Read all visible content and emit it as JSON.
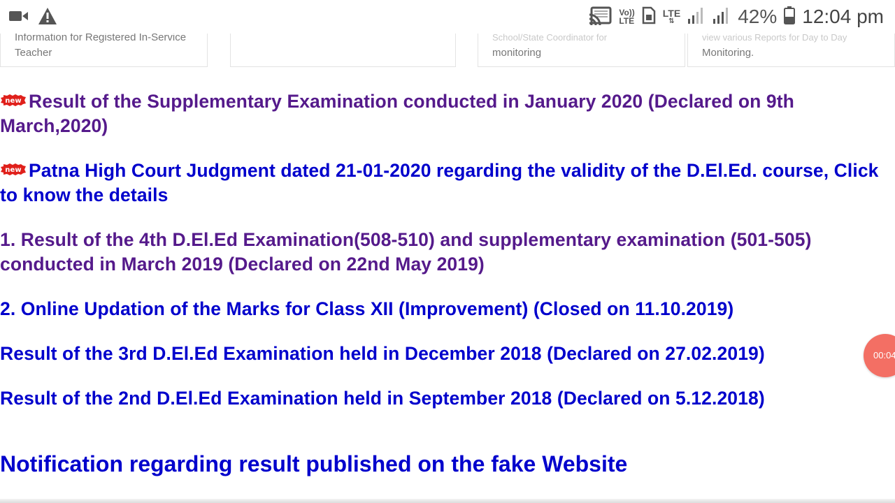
{
  "status_bar": {
    "icons_left": [
      "video-camera-icon",
      "warning-icon"
    ],
    "icons_right": [
      "cast-icon",
      "volte-icon",
      "sim-icon",
      "lte-signal-icon",
      "signal-icon-1",
      "signal-icon-2",
      "battery-icon"
    ],
    "volte_top": "Vo))",
    "volte_bottom": "LTE",
    "lte_label": "LTE",
    "battery": "42%",
    "time": "12:04 pm"
  },
  "cards": [
    {
      "text": "Information for Registered In-Service Teacher",
      "ghost": ""
    },
    {
      "text": "",
      "ghost": ""
    },
    {
      "text": "monitoring",
      "ghost": "School/State Coordinator for"
    },
    {
      "text": "Monitoring.",
      "ghost": "view various Reports for Day to Day"
    }
  ],
  "links": [
    {
      "text": "Result of the Supplementary Examination conducted in January 2020 (Declared on 9th March,2020)",
      "new": true,
      "state": "visited"
    },
    {
      "text": "Patna High Court Judgment dated 21-01-2020 regarding the validity of the D.El.Ed. course, Click to know the details",
      "new": true,
      "state": "fresh"
    },
    {
      "text": "1. Result of the 4th D.El.Ed Examination(508-510) and supplementary examination (501-505) conducted in March 2019 (Declared on 22nd May 2019)",
      "new": false,
      "state": "visited"
    },
    {
      "text": "2. Online Updation of the Marks for Class XII (Improvement) (Closed on 11.10.2019)",
      "new": false,
      "state": "fresh"
    },
    {
      "text": "Result of the 3rd D.El.Ed Examination held in December 2018 (Declared on 27.02.2019)",
      "new": false,
      "state": "fresh"
    },
    {
      "text": "Result of the 2nd D.El.Ed Examination held in September 2018 (Declared on 5.12.2018)",
      "new": false,
      "state": "fresh"
    }
  ],
  "new_badge_label": "new",
  "notice": "Notification regarding result published on the fake Website",
  "recording_timer": "00:04",
  "colors": {
    "visited_link": "#551a8b",
    "fresh_link": "#0000cc",
    "badge_red": "#e0201b",
    "record_bubble": "#f36f64"
  }
}
